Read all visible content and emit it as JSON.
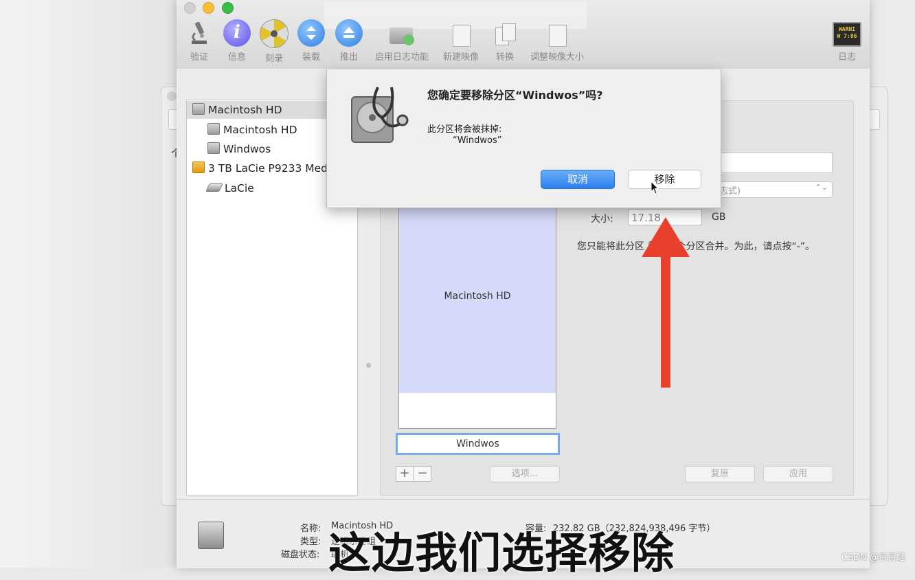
{
  "toolbar": {
    "buttons": [
      {
        "id": "verify",
        "label": "验证",
        "icon": "microscope-icon"
      },
      {
        "id": "info",
        "label": "信息",
        "icon": "info-icon"
      },
      {
        "id": "burn",
        "label": "刻录",
        "icon": "burn-icon"
      },
      {
        "id": "mount",
        "label": "装载",
        "icon": "mount-icon"
      },
      {
        "id": "eject",
        "label": "推出",
        "icon": "eject-icon"
      },
      {
        "id": "journal",
        "label": "启用日志功能",
        "icon": "journal-icon"
      },
      {
        "id": "new_image",
        "label": "新建映像",
        "icon": "new-image-icon"
      },
      {
        "id": "convert",
        "label": "转换",
        "icon": "convert-icon"
      },
      {
        "id": "resize",
        "label": "调整映像大小",
        "icon": "resize-image-icon"
      },
      {
        "id": "log",
        "label": "日志",
        "icon": "log-icon"
      }
    ],
    "log_icon_text_1": "WARNI",
    "log_icon_text_2": "W 7:86"
  },
  "sidebar": {
    "items": [
      {
        "label": "Macintosh HD",
        "level": 0,
        "icon": "internal-disk-icon",
        "selected": true
      },
      {
        "label": "Macintosh HD",
        "level": 1,
        "icon": "volume-icon"
      },
      {
        "label": "Windwos",
        "level": 1,
        "icon": "volume-icon"
      },
      {
        "label": "3 TB LaCie P9233 Med",
        "level": 0,
        "icon": "external-disk-icon"
      },
      {
        "label": "LaCie",
        "level": 1,
        "icon": "volume-flat-icon"
      }
    ],
    "bg_char": "个"
  },
  "partition": {
    "map_main_label": "Macintosh HD",
    "map_selected_label": "Windwos",
    "add_label": "+",
    "remove_label": "−",
    "options_label": "选项...",
    "revert_label": "复原",
    "apply_label": "应用",
    "format_value": "志式)",
    "size_label": "大小:",
    "size_value": "17.18",
    "size_unit": "GB",
    "hint": "您只能将此分区      前的一个分区合并。为此，请点按“-”。"
  },
  "dialog": {
    "title": "您确定要移除分区“Windwos”吗?",
    "message": "此分区将会被抹掉:",
    "partition_name": "“Windwos”",
    "cancel_label": "取消",
    "remove_label": "移除",
    "accent": "#2a7ff0"
  },
  "info": {
    "name_label": "名称:",
    "name_value": "Macintosh HD",
    "type_label": "类型:",
    "type_value": "逻辑宗卷组",
    "status_label": "磁盘状态:",
    "status_value": "联机",
    "capacity_label": "容量:",
    "capacity_value": "232.82 GB（232,824,938,496 字节）"
  },
  "overlay": {
    "caption": "这边我们选择移除",
    "watermark": "CSDN @吉吉蛙",
    "arrow_color": "#e8402c"
  }
}
